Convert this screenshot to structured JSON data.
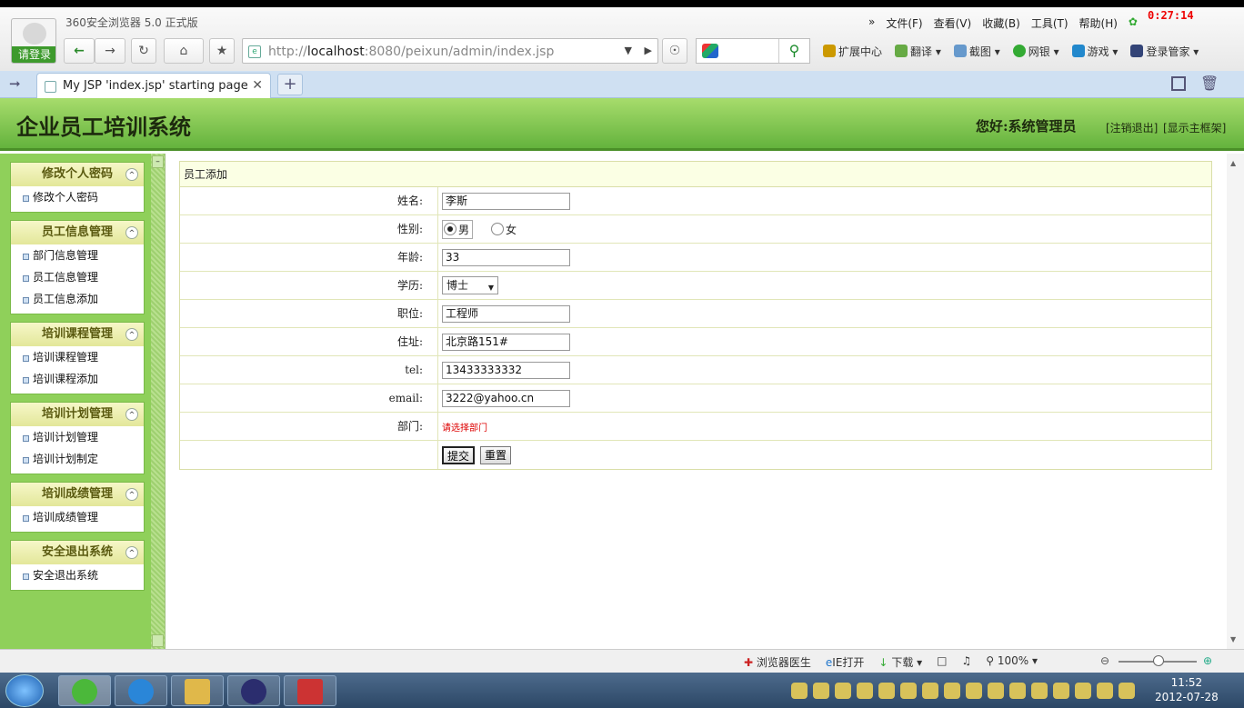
{
  "browser": {
    "app_title": "360安全浏览器 5.0 正式版",
    "login_label": "请登录",
    "menu": [
      "文件(F)",
      "查看(V)",
      "收藏(B)",
      "工具(T)",
      "帮助(H)"
    ],
    "rec_time": "0:27:14",
    "address": {
      "prefix": "http://",
      "host": "localhost",
      "rest": ":8080/peixun/admin/index.jsp"
    },
    "extensions": [
      "扩展中心",
      "翻译",
      "截图",
      "网银",
      "游戏",
      "登录管家"
    ],
    "tab_title": "My JSP 'index.jsp' starting page"
  },
  "header": {
    "system_title": "企业员工培训系统",
    "greeting": "您好:系统管理员",
    "logout": "[注销退出]",
    "show_main": "[显示主框架]"
  },
  "sidebar": {
    "groups": [
      {
        "title": "修改个人密码",
        "items": [
          "修改个人密码"
        ]
      },
      {
        "title": "员工信息管理",
        "items": [
          "部门信息管理",
          "员工信息管理",
          "员工信息添加"
        ]
      },
      {
        "title": "培训课程管理",
        "items": [
          "培训课程管理",
          "培训课程添加"
        ]
      },
      {
        "title": "培训计划管理",
        "items": [
          "培训计划管理",
          "培训计划制定"
        ]
      },
      {
        "title": "培训成绩管理",
        "items": [
          "培训成绩管理"
        ]
      },
      {
        "title": "安全退出系统",
        "items": [
          "安全退出系统"
        ]
      }
    ]
  },
  "form": {
    "caption": "员工添加",
    "name_label": "姓名:",
    "name_value": "李斯",
    "gender_label": "性别:",
    "gender_male": "男",
    "gender_female": "女",
    "age_label": "年龄:",
    "age_value": "33",
    "edu_label": "学历:",
    "edu_value": "博士",
    "position_label": "职位:",
    "position_value": "工程师",
    "address_label": "住址:",
    "address_value": "北京路151#",
    "tel_label": "tel:",
    "tel_value": "13433333332",
    "email_label": "email:",
    "email_value": "3222@yahoo.cn",
    "dept_label": "部门:",
    "dept_hint": "请选择部门",
    "submit": "提交",
    "reset": "重置"
  },
  "statusbar": {
    "doctor": "浏览器医生",
    "ie_open": "IE打开",
    "download": "下载",
    "zoom": "100%"
  },
  "taskbar": {
    "time": "11:52",
    "date": "2012-07-28"
  }
}
